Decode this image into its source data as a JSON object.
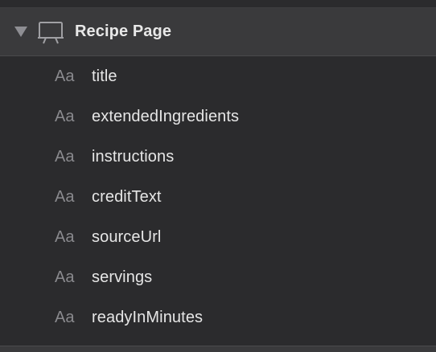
{
  "header": {
    "title": "Recipe Page",
    "disclosure_icon": "disclosure-triangle-down-icon",
    "page_icon": "presentation-board-icon"
  },
  "fields": {
    "type_icon_text": "Aa",
    "items": [
      {
        "label": "title"
      },
      {
        "label": "extendedIngredients"
      },
      {
        "label": "instructions"
      },
      {
        "label": "creditText"
      },
      {
        "label": "sourceUrl"
      },
      {
        "label": "servings"
      },
      {
        "label": "readyInMinutes"
      }
    ]
  },
  "colors": {
    "background": "#2b2b2d",
    "header_background": "#3a3a3c",
    "text": "#e6e6e6",
    "icon": "#8a8a8e"
  }
}
